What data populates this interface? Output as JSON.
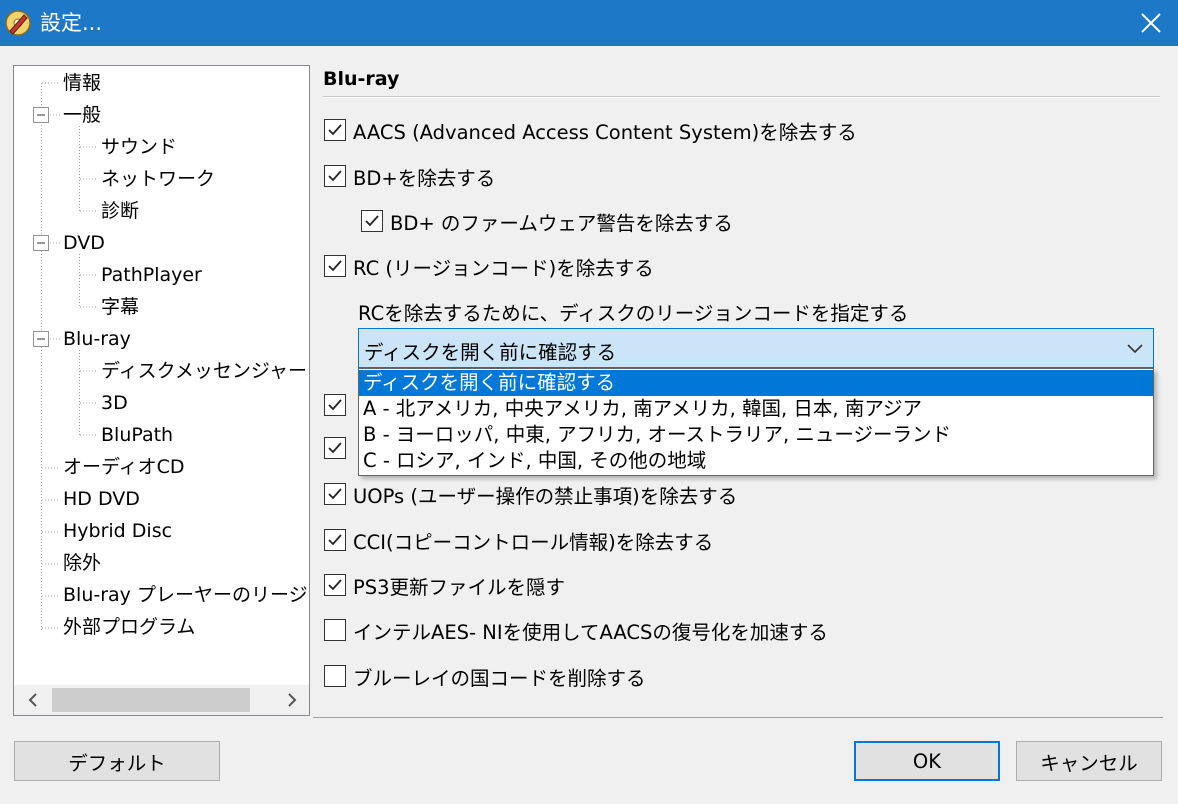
{
  "window": {
    "title": "設定..."
  },
  "tree": {
    "items": [
      {
        "label": "情報"
      },
      {
        "label": "一般"
      },
      {
        "label": "サウンド"
      },
      {
        "label": "ネットワーク"
      },
      {
        "label": "診断"
      },
      {
        "label": "DVD"
      },
      {
        "label": "PathPlayer"
      },
      {
        "label": "字幕"
      },
      {
        "label": "Blu-ray"
      },
      {
        "label": "ディスクメッセンジャー"
      },
      {
        "label": "3D"
      },
      {
        "label": "BluPath"
      },
      {
        "label": "オーディオCD"
      },
      {
        "label": "HD DVD"
      },
      {
        "label": "Hybrid Disc"
      },
      {
        "label": "除外"
      },
      {
        "label": "Blu-ray プレーヤーのリージ"
      },
      {
        "label": "外部プログラム"
      }
    ],
    "selected": "Blu-ray",
    "scroll_left_icon": "chevron-left-icon",
    "scroll_right_icon": "chevron-right-icon"
  },
  "section": {
    "title": "Blu-ray",
    "options": [
      {
        "label": "AACS (Advanced Access Content System)を除去する",
        "checked": true
      },
      {
        "label": "BD+を除去する",
        "checked": true
      },
      {
        "label": "BD+ のファームウェア警告を除去する",
        "checked": true
      },
      {
        "label": "RC (リージョンコード)を除去する",
        "checked": true
      },
      {
        "label": "UOPs (ユーザー操作の禁止事項)を除去する",
        "checked": true
      },
      {
        "label": "CCI(コピーコントロール情報)を除去する",
        "checked": true
      },
      {
        "label": "PS3更新ファイルを隠す",
        "checked": true
      },
      {
        "label": "インテルAES- NIを使用してAACSの復号化を加速する",
        "checked": false
      },
      {
        "label": "ブルーレイの国コードを削除する",
        "checked": false
      }
    ],
    "region_prompt": "RCを除去するために、ディスクのリージョンコードを指定する",
    "region_combo": {
      "value": "ディスクを開く前に確認する",
      "options": [
        "ディスクを開く前に確認する",
        "A - 北アメリカ, 中央アメリカ, 南アメリカ, 韓国, 日本, 南アジア",
        "B - ヨーロッパ, 中東, アフリカ, オーストラリア, ニュージーランド",
        "C - ロシア, インド, 中国, その他の地域"
      ]
    }
  },
  "buttons": {
    "default": "デフォルト",
    "ok": "OK",
    "cancel": "キャンセル"
  },
  "colors": {
    "titlebar": "#1e78c8",
    "accent": "#0078d7",
    "background": "#f0f0f0"
  }
}
